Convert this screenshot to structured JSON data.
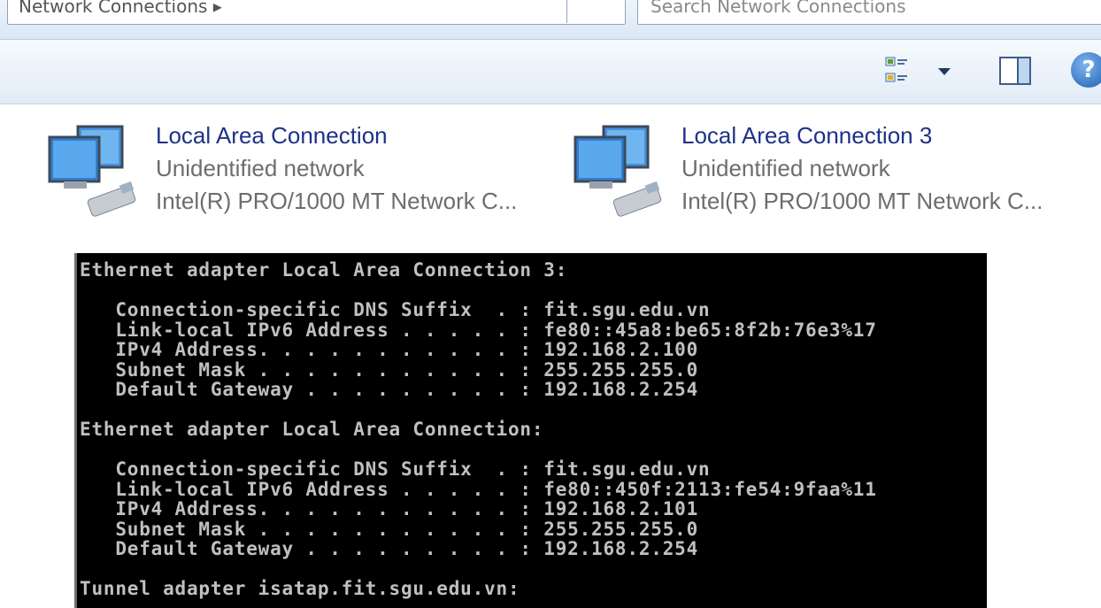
{
  "address_bar": {
    "text": "Network Connections ▸"
  },
  "search_box": {
    "placeholder": "Search Network Connections"
  },
  "toolbar": {
    "views_icon": "change-view-icon",
    "preview_icon": "preview-pane-icon",
    "help_label": "?"
  },
  "connections": [
    {
      "name": "Local Area Connection",
      "status": "Unidentified network",
      "device": "Intel(R) PRO/1000 MT Network C..."
    },
    {
      "name": "Local Area Connection 3",
      "status": "Unidentified network",
      "device": "Intel(R) PRO/1000 MT Network C..."
    }
  ],
  "console": {
    "lines": [
      "Ethernet adapter Local Area Connection 3:",
      "",
      "   Connection-specific DNS Suffix  . : fit.sgu.edu.vn",
      "   Link-local IPv6 Address . . . . . : fe80::45a8:be65:8f2b:76e3%17",
      "   IPv4 Address. . . . . . . . . . . : 192.168.2.100",
      "   Subnet Mask . . . . . . . . . . . : 255.255.255.0",
      "   Default Gateway . . . . . . . . . : 192.168.2.254",
      "",
      "Ethernet adapter Local Area Connection:",
      "",
      "   Connection-specific DNS Suffix  . : fit.sgu.edu.vn",
      "   Link-local IPv6 Address . . . . . : fe80::450f:2113:fe54:9faa%11",
      "   IPv4 Address. . . . . . . . . . . : 192.168.2.101",
      "   Subnet Mask . . . . . . . . . . . : 255.255.255.0",
      "   Default Gateway . . . . . . . . . : 192.168.2.254",
      "",
      "Tunnel adapter isatap.fit.sgu.edu.vn:"
    ]
  },
  "colors": {
    "link": "#1e3287",
    "subtext": "#6d6d6d",
    "console_bg": "#000000",
    "console_fg": "#c0c0c0"
  }
}
